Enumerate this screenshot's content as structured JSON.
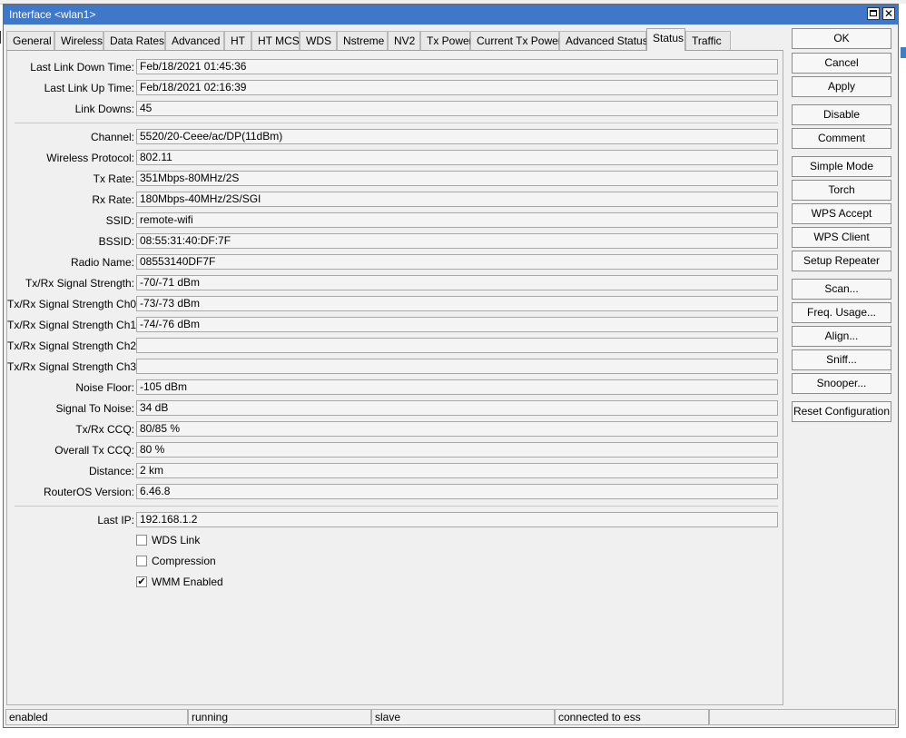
{
  "window": {
    "title": "Interface <wlan1>"
  },
  "tabs": [
    "General",
    "Wireless",
    "Data Rates",
    "Advanced",
    "HT",
    "HT MCS",
    "WDS",
    "Nstreme",
    "NV2",
    "Tx Power",
    "Current Tx Power",
    "Advanced Status",
    "Status",
    "Traffic"
  ],
  "active_tab": "Status",
  "fields": [
    {
      "label": "Last Link Down Time:",
      "value": "Feb/18/2021 01:45:36"
    },
    {
      "label": "Last Link Up Time:",
      "value": "Feb/18/2021 02:16:39"
    },
    {
      "label": "Link Downs:",
      "value": "45"
    },
    {
      "label": "Channel:",
      "value": "5520/20-Ceee/ac/DP(11dBm)"
    },
    {
      "label": "Wireless Protocol:",
      "value": "802.11"
    },
    {
      "label": "Tx Rate:",
      "value": "351Mbps-80MHz/2S"
    },
    {
      "label": "Rx Rate:",
      "value": "180Mbps-40MHz/2S/SGI"
    },
    {
      "label": "SSID:",
      "value": "remote-wifi"
    },
    {
      "label": "BSSID:",
      "value": "08:55:31:40:DF:7F"
    },
    {
      "label": "Radio Name:",
      "value": "08553140DF7F"
    },
    {
      "label": "Tx/Rx Signal Strength:",
      "value": "-70/-71 dBm"
    },
    {
      "label": "Tx/Rx Signal Strength Ch0:",
      "value": "-73/-73 dBm"
    },
    {
      "label": "Tx/Rx Signal Strength Ch1:",
      "value": "-74/-76 dBm"
    },
    {
      "label": "Tx/Rx Signal Strength Ch2:",
      "value": ""
    },
    {
      "label": "Tx/Rx Signal Strength Ch3:",
      "value": ""
    },
    {
      "label": "Noise Floor:",
      "value": "-105 dBm"
    },
    {
      "label": "Signal To Noise:",
      "value": "34 dB"
    },
    {
      "label": "Tx/Rx CCQ:",
      "value": "80/85 %"
    },
    {
      "label": "Overall Tx CCQ:",
      "value": "80 %"
    },
    {
      "label": "Distance:",
      "value": "2 km"
    },
    {
      "label": "RouterOS Version:",
      "value": "6.46.8"
    },
    {
      "label": "Last IP:",
      "value": "192.168.1.2"
    }
  ],
  "checkboxes": [
    {
      "label": "WDS Link",
      "checked": false
    },
    {
      "label": "Compression",
      "checked": false
    },
    {
      "label": "WMM Enabled",
      "checked": true
    }
  ],
  "checkmark": "✔",
  "buttons": [
    "OK",
    "Cancel",
    "Apply",
    "Disable",
    "Comment",
    "Simple Mode",
    "Torch",
    "WPS Accept",
    "WPS Client",
    "Setup Repeater",
    "Scan...",
    "Freq. Usage...",
    "Align...",
    "Sniff...",
    "Snooper...",
    "Reset Configuration"
  ],
  "statusbar": [
    "enabled",
    "running",
    "slave",
    "connected to ess",
    ""
  ],
  "colors": {
    "titlebar": "#3f78c8"
  }
}
